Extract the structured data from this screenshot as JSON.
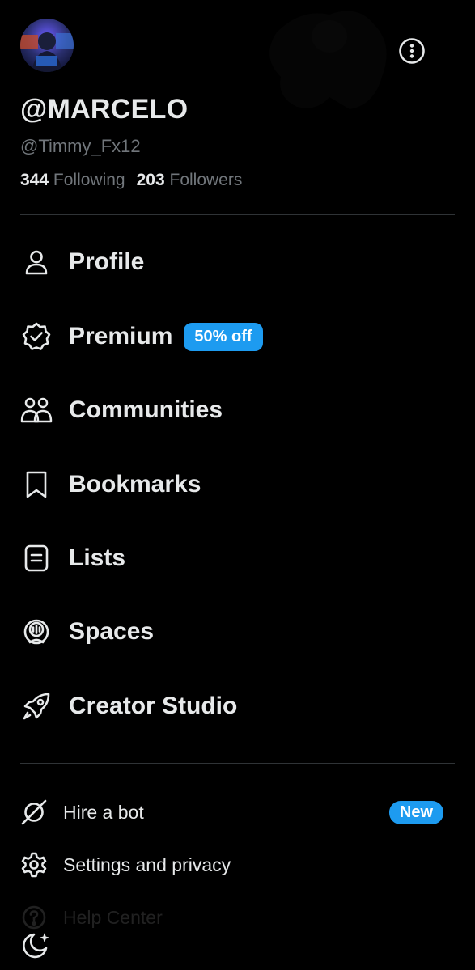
{
  "profile": {
    "display_name": "@MARCELO",
    "handle": "@Timmy_Fx12",
    "following_count": "344",
    "following_label": "Following",
    "followers_count": "203",
    "followers_label": "Followers"
  },
  "menu": [
    {
      "label": "Profile",
      "icon": "person-icon"
    },
    {
      "label": "Premium",
      "icon": "verified-badge-icon",
      "badge": "50% off"
    },
    {
      "label": "Communities",
      "icon": "communities-icon"
    },
    {
      "label": "Bookmarks",
      "icon": "bookmark-icon"
    },
    {
      "label": "Lists",
      "icon": "list-icon"
    },
    {
      "label": "Spaces",
      "icon": "spaces-icon"
    },
    {
      "label": "Creator Studio",
      "icon": "rocket-icon"
    }
  ],
  "secondary": [
    {
      "label": "Hire a bot",
      "icon": "grok-icon",
      "badge": "New"
    },
    {
      "label": "Settings and privacy",
      "icon": "gear-icon"
    },
    {
      "label": "Help Center",
      "icon": "help-icon"
    }
  ],
  "colors": {
    "background": "#000000",
    "text_primary": "#e7e9ea",
    "text_secondary": "#71767b",
    "accent": "#1d9bf0",
    "divider": "#2f3336"
  }
}
